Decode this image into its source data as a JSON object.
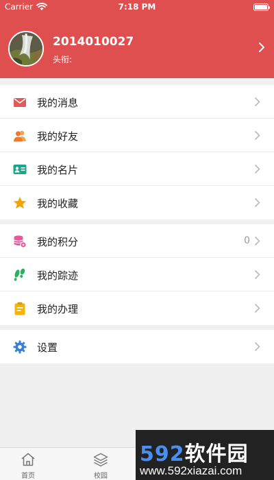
{
  "status_bar": {
    "carrier": "Carrier",
    "time": "7:18 PM"
  },
  "profile": {
    "name": "2014010027",
    "title_label": "头衔:",
    "title_value": ""
  },
  "menu_group_1": [
    {
      "label": "我的消息",
      "icon": "mail-icon",
      "color": "#e05a5a"
    },
    {
      "label": "我的好友",
      "icon": "friends-icon",
      "color": "#f08a3c"
    },
    {
      "label": "我的名片",
      "icon": "id-card-icon",
      "color": "#1aa58c"
    },
    {
      "label": "我的收藏",
      "icon": "star-icon",
      "color": "#f5a300"
    }
  ],
  "menu_group_2": [
    {
      "label": "我的积分",
      "icon": "coins-icon",
      "color": "#e55a9b",
      "value": "0"
    },
    {
      "label": "我的踪迹",
      "icon": "footprint-icon",
      "color": "#2bb05d"
    },
    {
      "label": "我的办理",
      "icon": "clipboard-icon",
      "color": "#f5b400"
    }
  ],
  "menu_group_3": [
    {
      "label": "设置",
      "icon": "gear-icon",
      "color": "#3a7fd4"
    }
  ],
  "tabbar": [
    {
      "label": "首页",
      "icon": "home-icon"
    },
    {
      "label": "校园",
      "icon": "layers-icon"
    }
  ],
  "watermark": {
    "brand_num": "592",
    "brand_text": "软件园",
    "url": "www.592xiazai.com"
  }
}
